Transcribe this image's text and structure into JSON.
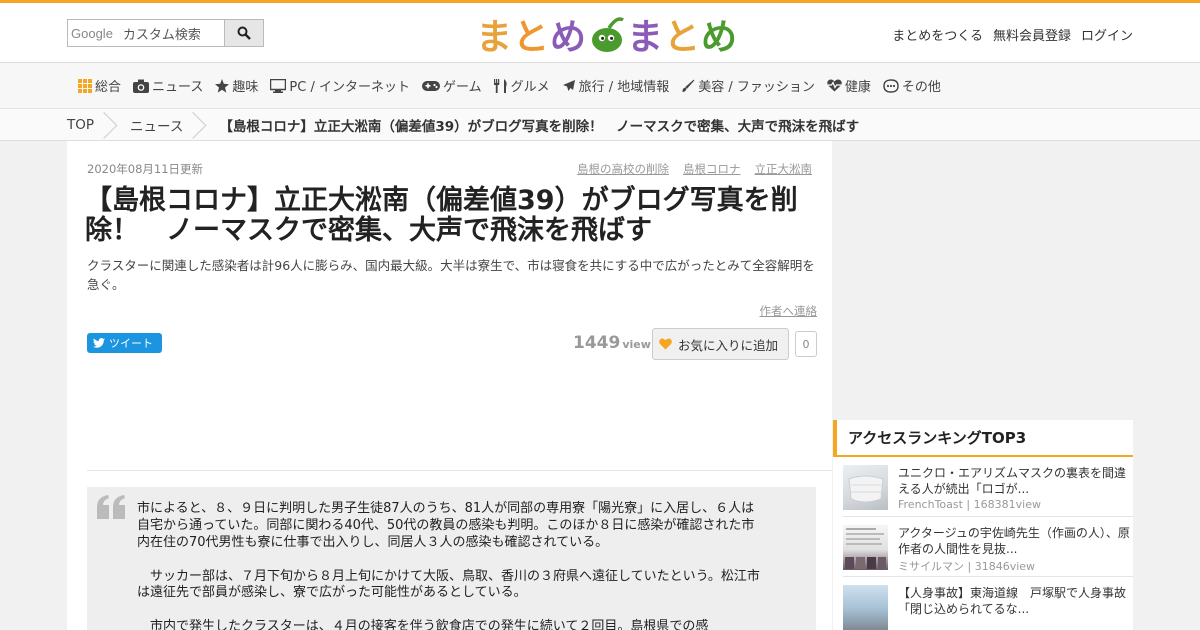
{
  "header": {
    "search_brand": "Google",
    "search_placeholder": "カスタム検索",
    "logo_left": "まとめ",
    "logo_right": "まとめ",
    "links": [
      "まとめをつくる",
      "無料会員登録",
      "ログイン"
    ],
    "accent_color": "#f5a623"
  },
  "nav": {
    "items": [
      {
        "label": "総合",
        "icon": "grid-icon"
      },
      {
        "label": "ニュース",
        "icon": "camera-icon"
      },
      {
        "label": "趣味",
        "icon": "star-icon"
      },
      {
        "label": "PC / インターネット",
        "icon": "monitor-icon"
      },
      {
        "label": "ゲーム",
        "icon": "gamepad-icon"
      },
      {
        "label": "グルメ",
        "icon": "cutlery-icon"
      },
      {
        "label": "旅行 / 地域情報",
        "icon": "plane-icon"
      },
      {
        "label": "美容 / ファッション",
        "icon": "brush-icon"
      },
      {
        "label": "健康",
        "icon": "heartbeat-icon"
      },
      {
        "label": "その他",
        "icon": "ellipsis-icon"
      }
    ]
  },
  "breadcrumb": {
    "items": [
      "TOP",
      "ニュース",
      "【島根コロナ】立正大淞南（偏差値39）がブログ写真を削除！　ノーマスクで密集、大声で飛沫を飛ばす"
    ]
  },
  "article": {
    "date": "2020年08月11日更新",
    "tags": [
      "島根の高校の削除",
      "島根コロナ",
      "立正大淞南"
    ],
    "title": "【島根コロナ】立正大淞南（偏差値39）がブログ写真を削除！　ノーマスクで密集、大声で飛沫を飛ばす",
    "description": "クラスターに関連した感染者は計96人に膨らみ、国内最大級。大半は寮生で、市は寝食を共にする中で広がったとみて全容解明を急ぐ。",
    "contact_link": "作者へ連絡",
    "tweet_label": "ツイート",
    "views": "1449",
    "views_unit": "view",
    "favorite_label": "お気に入りに追加",
    "favorite_count": "0",
    "quote": "市によると、８、９日に判明した男子生徒87人のうち、81人が同部の専用寮「陽光寮」に入居し、６人は自宅から通っていた。同部に関わる40代、50代の教員の感染も判明。このほか８日に感染が確認された市内在住の70代男性も寮に仕事で出入りし、同居人３人の感染も確認されている。\n\n　サッカー部は、７月下旬から８月上旬にかけて大阪、鳥取、香川の３府県へ遠征していたという。松江市は遠征先で部員が感染し、寮で広がった可能性があるとしている。\n\n　市内で発生したクラスターは、４月の接客を伴う飲食店での発生に続いて２回目。島根県での感"
  },
  "ranking": {
    "heading": "アクセスランキングTOP3",
    "items": [
      {
        "title": "ユニクロ・エアリズムマスクの裏表を間違える人が続出「ロゴが...",
        "author": "FrenchToast",
        "views": "168381view"
      },
      {
        "title": "アクタージュの宇佐崎先生（作画の人）、原作者の人間性を見抜...",
        "author": "ミサイルマン",
        "views": "31846view"
      },
      {
        "title": "【人身事故】東海道線　戸塚駅で人身事故「閉じ込められてるな...",
        "author": "",
        "views": ""
      }
    ]
  }
}
